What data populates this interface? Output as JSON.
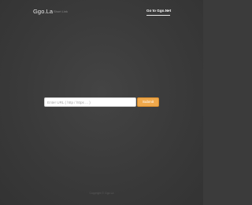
{
  "header": {
    "brand": "Ggo.La",
    "brand_sub": "Short Link",
    "nav_link": "Go to Ggo.Net"
  },
  "form": {
    "url_placeholder": "Enter URL ( http / https ... )",
    "url_value": "",
    "submit_label": "Submit"
  },
  "footer": {
    "text": "Copyright © Ggo.La"
  },
  "colors": {
    "background": "#3b3b3b",
    "accent": "#efa84b",
    "text_primary": "#e6e6e6"
  }
}
